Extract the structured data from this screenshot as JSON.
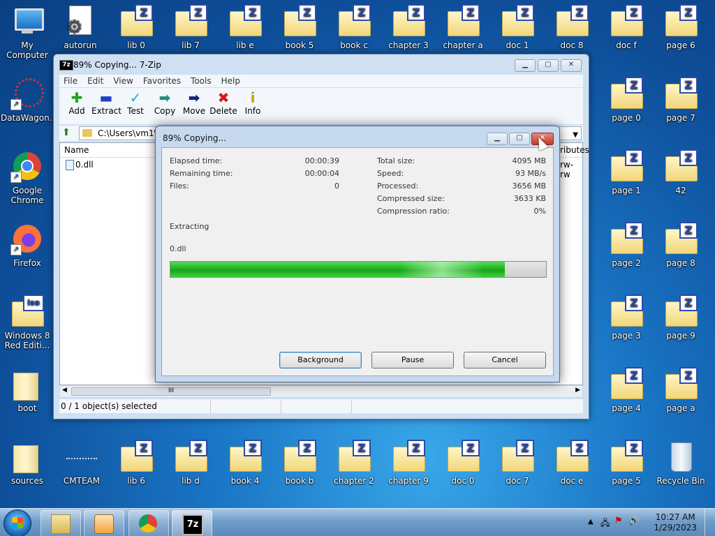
{
  "desktop_icons_top": [
    {
      "label": "My Computer",
      "kind": "monitor"
    },
    {
      "label": "autorun",
      "kind": "gear"
    },
    {
      "label": "lib 0",
      "kind": "z"
    },
    {
      "label": "lib 7",
      "kind": "z"
    },
    {
      "label": "lib e",
      "kind": "z"
    },
    {
      "label": "book 5",
      "kind": "z"
    },
    {
      "label": "book c",
      "kind": "z"
    },
    {
      "label": "chapter 3",
      "kind": "z"
    },
    {
      "label": "chapter a",
      "kind": "z"
    },
    {
      "label": "doc 1",
      "kind": "z"
    },
    {
      "label": "doc 8",
      "kind": "z"
    },
    {
      "label": "doc f",
      "kind": "z"
    },
    {
      "label": "page 6",
      "kind": "z"
    }
  ],
  "desktop_icons_left": [
    {
      "label": "DataWagon...",
      "kind": "shortcut"
    },
    {
      "label": "Google Chrome",
      "kind": "chrome"
    },
    {
      "label": "Firefox",
      "kind": "firefox"
    },
    {
      "label": "Windows 8 Red Editi...",
      "kind": "iso"
    },
    {
      "label": "boot",
      "kind": "folder"
    },
    {
      "label": "sources",
      "kind": "folder"
    }
  ],
  "desktop_icons_right_col1": [
    "page 0",
    "page 1",
    "page 2",
    "page 3",
    "page 4",
    "page 5"
  ],
  "desktop_icons_right_col2": [
    "page 7",
    "42",
    "page 8",
    "page 9",
    "page a",
    "Recycle Bin"
  ],
  "desktop_icons_bottom": [
    "CMTEAM",
    "lib 6",
    "lib d",
    "book 4",
    "book b",
    "chapter 2",
    "chapter 9",
    "doc 0",
    "doc 7",
    "doc e"
  ],
  "main_window": {
    "title": "89% Copying... 7-Zip",
    "app_icon_text": "7z",
    "menu": [
      "File",
      "Edit",
      "View",
      "Favorites",
      "Tools",
      "Help"
    ],
    "toolbar": [
      {
        "label": "Add",
        "glyph": "✚",
        "color": "#1fa51f"
      },
      {
        "label": "Extract",
        "glyph": "▬",
        "color": "#1f3fbf"
      },
      {
        "label": "Test",
        "glyph": "✓",
        "color": "#1aa9c9"
      },
      {
        "label": "Copy",
        "glyph": "➡",
        "color": "#1f8f7f"
      },
      {
        "label": "Move",
        "glyph": "➡",
        "color": "#15237a"
      },
      {
        "label": "Delete",
        "glyph": "✖",
        "color": "#d11b1b"
      },
      {
        "label": "Info",
        "glyph": "i",
        "color": "#c9a400"
      }
    ],
    "address": "C:\\Users\\vm1\\D",
    "column_name": "Name",
    "column_attributes": "ributes",
    "file_row": {
      "name": "0.dll",
      "attr": "rw-rw"
    },
    "scroll_thumb": "III",
    "status_selected": "0 / 1 object(s) selected"
  },
  "progress_dialog": {
    "title": "89% Copying...",
    "left_labels": [
      "Elapsed time:",
      "Remaining time:",
      "Files:"
    ],
    "left_values": [
      "00:00:39",
      "00:00:04",
      "0"
    ],
    "right_labels": [
      "Total size:",
      "Speed:",
      "Processed:",
      "Compressed size:",
      "Compression ratio:"
    ],
    "right_values": [
      "4095 MB",
      "93 MB/s",
      "3656 MB",
      "3633 KB",
      "0%"
    ],
    "operation": "Extracting",
    "current_file": "0.dll",
    "progress_fraction": 0.89,
    "buttons": {
      "background": "Background",
      "pause": "Pause",
      "cancel": "Cancel"
    }
  },
  "taskbar": {
    "time": "10:27 AM",
    "date": "1/29/2023",
    "seven_zip_label": "7z"
  }
}
